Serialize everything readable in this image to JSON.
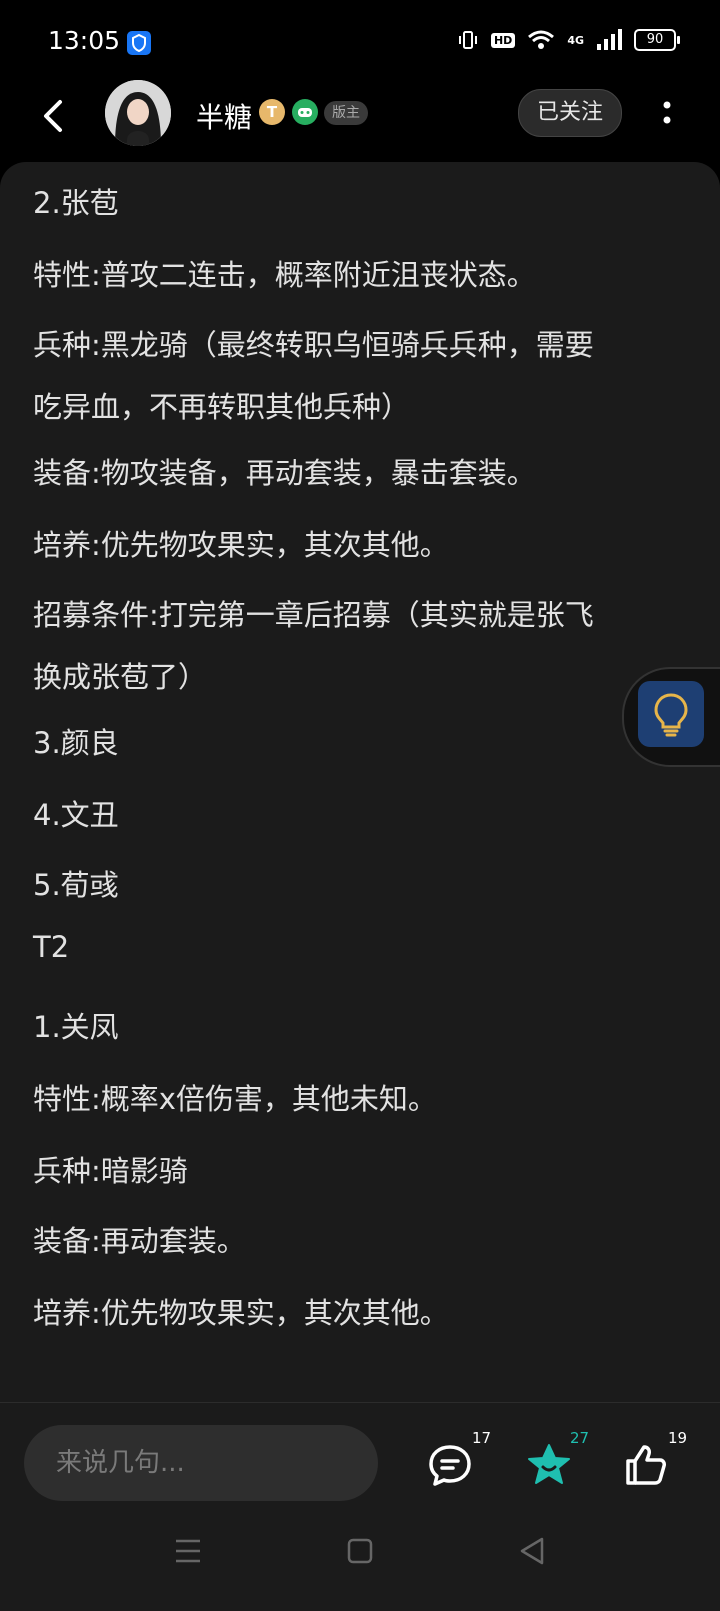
{
  "status_bar": {
    "time": "13:05",
    "hd": "HD",
    "network": "4G",
    "battery": "90"
  },
  "header": {
    "username": "半糖",
    "badge_t": "T",
    "mod_badge": "版主",
    "follow_label": "已关注"
  },
  "content": {
    "lines": [
      "2.张苞",
      "特性:普攻二连击，概率附近沮丧状态。",
      "兵种:黑龙骑（最终转职乌恒骑兵兵种，需要",
      "吃异血，不再转职其他兵种）",
      "装备:物攻装备，再动套装，暴击套装。",
      "培养:优先物攻果实，其次其他。",
      "招募条件:打完第一章后招募（其实就是张飞",
      "换成张苞了）",
      "3.颜良",
      "4.文丑",
      "5.荀彧",
      "T2",
      "1.关凤",
      "特性:概率x倍伤害，其他未知。",
      "兵种:暗影骑",
      "装备:再动套装。",
      "培养:优先物攻果实，其次其他。"
    ]
  },
  "bottom_bar": {
    "comment_placeholder": "来说几句...",
    "comment_count": "17",
    "favorite_count": "27",
    "like_count": "19"
  },
  "colors": {
    "background": "#1b1b1b",
    "accent_teal": "#1fbfb0",
    "text": "#e2e2e2"
  }
}
